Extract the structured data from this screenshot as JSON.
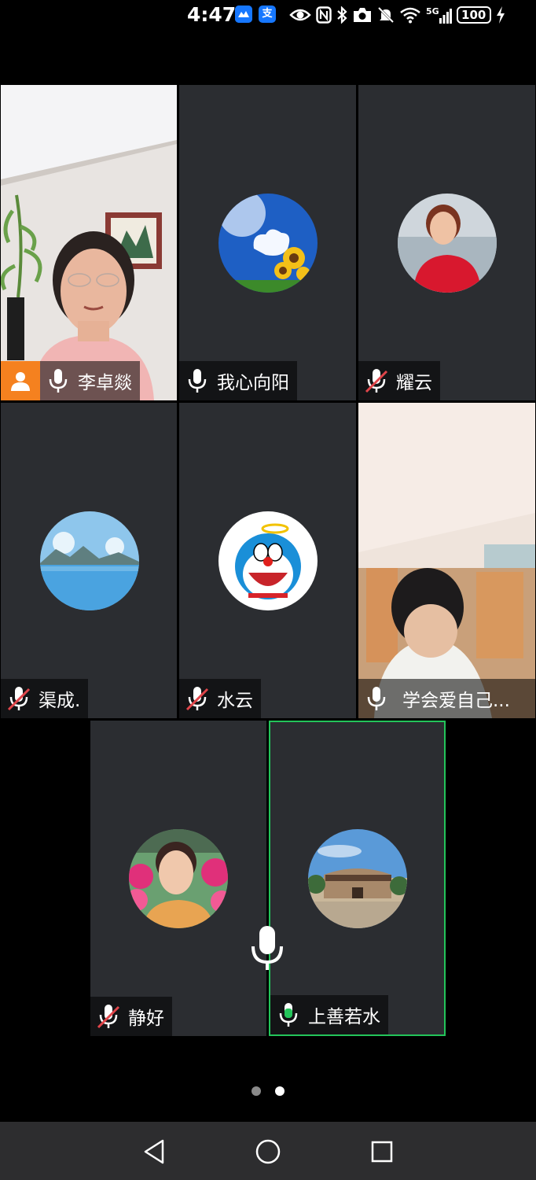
{
  "status_bar": {
    "time": "4:47",
    "app_icon_1": "chart-app-icon",
    "app_icon_2": "支",
    "network": "5G",
    "battery": "100"
  },
  "participants": [
    {
      "name": "李卓燚",
      "mic": "on",
      "video": true,
      "host": true
    },
    {
      "name": "我心向阳",
      "mic": "on",
      "video": false,
      "avatar": "sky-sunflower"
    },
    {
      "name": "耀云",
      "mic": "muted",
      "video": false,
      "avatar": "woman-red-shirt"
    },
    {
      "name": "渠成.",
      "mic": "muted",
      "video": false,
      "avatar": "lake-mountains"
    },
    {
      "name": "水云",
      "mic": "muted",
      "video": false,
      "avatar": "doraemon"
    },
    {
      "name": "学会爱自己...",
      "mic": "on",
      "video": true
    },
    {
      "name": "静好",
      "mic": "muted",
      "video": false,
      "avatar": "woman-flowers"
    },
    {
      "name": "上善若水",
      "mic": "speaking",
      "video": false,
      "avatar": "tulou-building",
      "active": true
    }
  ],
  "page_indicator": {
    "total": 2,
    "current": 2
  },
  "colors": {
    "tile_bg": "#2b2d31",
    "active_border": "#23c45a",
    "host_badge": "#f5811f",
    "mute_slash": "#e0454a",
    "speaking_green": "#23c45a"
  },
  "nav": {
    "back": "back-icon",
    "home": "home-icon",
    "recents": "recents-icon"
  }
}
